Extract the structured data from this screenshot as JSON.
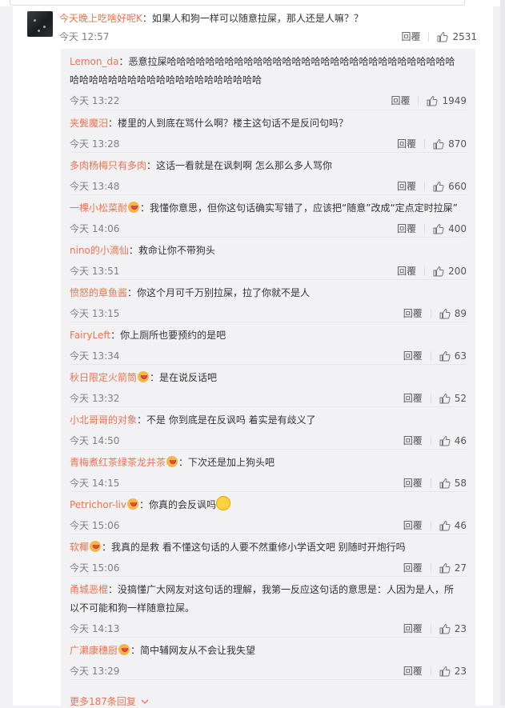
{
  "main_comment": {
    "user": "今天晚上吃啥好呢K",
    "text": "：如果人和狗一样可以随意拉屎，那人还是人嘛？？",
    "time": "今天 12:57",
    "reply_label": "回覆",
    "likes": "2531"
  },
  "replies": [
    {
      "user": "Lemon_da",
      "badge": false,
      "text": "：恶意拉屎哈哈哈哈哈哈哈哈哈哈哈哈哈哈哈哈哈哈哈哈哈哈哈哈哈哈哈哈哈哈哈哈哈哈哈哈哈哈哈哈哈哈哈哈哈哈哈哈哈哈",
      "time": "今天 13:22",
      "reply_label": "回覆",
      "likes": "1949"
    },
    {
      "user": "夹鬓魔汨",
      "badge": false,
      "text": "：楼里的人到底在骂什么啊？楼主这句话不是反问句吗？",
      "time": "今天 13:28",
      "reply_label": "回覆",
      "likes": "870"
    },
    {
      "user": "多肉杨梅只有多肉",
      "badge": false,
      "text": "：这话一看就是在讽刺啊 怎么那么多人骂你",
      "time": "今天 13:48",
      "reply_label": "回覆",
      "likes": "660"
    },
    {
      "user": "一棵小松菜耐",
      "badge": true,
      "text": "：我懂你意思，但你这句话确实写错了，应该把“随意”改成“定点定时拉屎”",
      "time": "今天 14:06",
      "reply_label": "回覆",
      "likes": "400"
    },
    {
      "user": "nino的小滴仙",
      "badge": false,
      "text": "：救命让你不带狗头",
      "time": "今天 13:51",
      "reply_label": "回覆",
      "likes": "200"
    },
    {
      "user": "愤怒的章鱼酱",
      "badge": false,
      "text": "：你这个月可千万别拉屎，拉了你就不是人",
      "time": "今天 13:15",
      "reply_label": "回覆",
      "likes": "89"
    },
    {
      "user": "FairyLeft",
      "badge": false,
      "text": "：你上厕所也要预约的是吧",
      "time": "今天 13:34",
      "reply_label": "回覆",
      "likes": "63"
    },
    {
      "user": "秋日限定火箭筒",
      "badge": true,
      "text": "：是在说反话吧",
      "time": "今天 13:32",
      "reply_label": "回覆",
      "likes": "52"
    },
    {
      "user": "小北哥哥的对象",
      "badge": false,
      "text": "：不是 你到底是在反讽吗 着实是有歧义了",
      "time": "今天 14:50",
      "reply_label": "回覆",
      "likes": "46"
    },
    {
      "user": "青梅煮红茶绿茶龙井茶",
      "badge": true,
      "text": "：下次还是加上狗头吧",
      "time": "今天 14:15",
      "reply_label": "回覆",
      "likes": "58"
    },
    {
      "user": "Petrichor-liv",
      "badge": true,
      "text": "：你真的会反讽吗",
      "emoji": true,
      "time": "今天 15:06",
      "reply_label": "回覆",
      "likes": "46"
    },
    {
      "user": "软椰",
      "badge": true,
      "text": "：我真的是救 看不懂这句话的人要不然重修小学语文吧 别随时开炮行吗",
      "time": "今天 15:06",
      "reply_label": "回覆",
      "likes": "27"
    },
    {
      "user": "甬城恶棍",
      "badge": false,
      "text": "：没搞懂广大网友对这句话的理解，我第一反应这句话的意思是：人因为是人，所以不可能和狗一样随意拉屎。",
      "time": "今天 14:13",
      "reply_label": "回覆",
      "likes": "23"
    },
    {
      "user": "广濑康穗厨",
      "badge": true,
      "text": "：简中辅网友从不会让我失望",
      "time": "今天 13:29",
      "reply_label": "回覆",
      "likes": "23"
    }
  ],
  "more_replies": "更多187条回复",
  "icons": {
    "like": "thumbs-up-icon",
    "more": "chevron-down-icon",
    "badge": "vip-badge-icon"
  },
  "colors": {
    "username": "#eb7350",
    "meta": "#808080",
    "sub_bg": "#f2f2f5"
  }
}
